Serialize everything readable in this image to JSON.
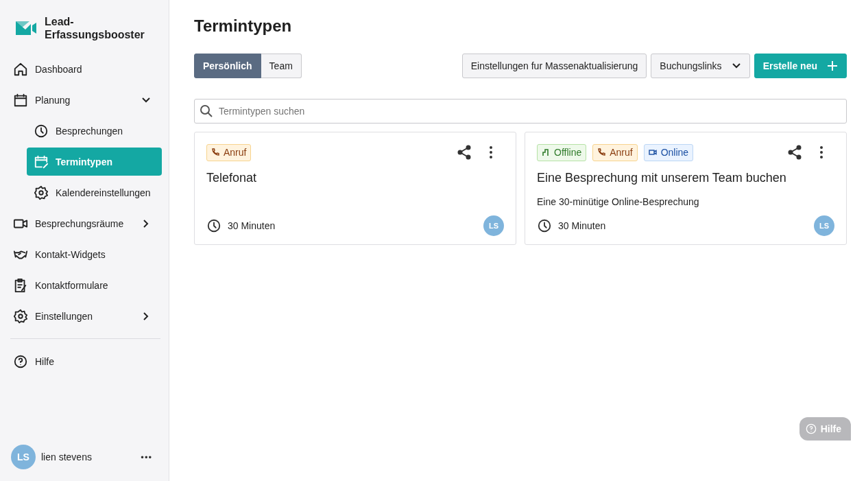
{
  "brand": {
    "name": "Lead-Erfassungsbooster"
  },
  "sidebar": {
    "items": [
      {
        "label": "Dashboard",
        "selected": false
      },
      {
        "label": "Planung",
        "selected": false,
        "expanded": true,
        "children": [
          {
            "label": "Besprechungen",
            "selected": false
          },
          {
            "label": "Termintypen",
            "selected": true
          },
          {
            "label": "Kalendereinstellungen",
            "selected": false
          }
        ]
      },
      {
        "label": "Besprechungsräume",
        "selected": false,
        "expanded": false
      },
      {
        "label": "Kontakt-Widgets",
        "selected": false
      },
      {
        "label": "Kontaktformulare",
        "selected": false
      },
      {
        "label": "Einstellungen",
        "selected": false,
        "expanded": false
      }
    ],
    "help": "Hilfe",
    "user": {
      "initials": "LS",
      "name": "lien stevens",
      "menu": "•••"
    }
  },
  "page": {
    "title": "Termintypen",
    "tabs": [
      {
        "label": "Persönlich",
        "selected": true
      },
      {
        "label": "Team",
        "selected": false
      }
    ],
    "buttons": {
      "bulk": "Einstellungen fur Massenaktualisierung",
      "links": "Buchungslinks",
      "create": "Erstelle neu"
    },
    "search": {
      "placeholder": "Termintypen suchen"
    },
    "cards": [
      {
        "tags": [
          {
            "kind": "call",
            "label": "Anruf"
          }
        ],
        "title": "Telefonat",
        "duration": "30 Minuten",
        "owner": "LS"
      },
      {
        "tags": [
          {
            "kind": "offline",
            "label": "Offline"
          },
          {
            "kind": "call",
            "label": "Anruf"
          },
          {
            "kind": "online",
            "label": "Online"
          }
        ],
        "title": "Eine Besprechung mit unserem Team buchen",
        "description": "Eine 30-minütige Online-Besprechung",
        "duration": "30 Minuten",
        "owner": "LS"
      }
    ]
  },
  "help_button": {
    "label": "Hilfe"
  }
}
